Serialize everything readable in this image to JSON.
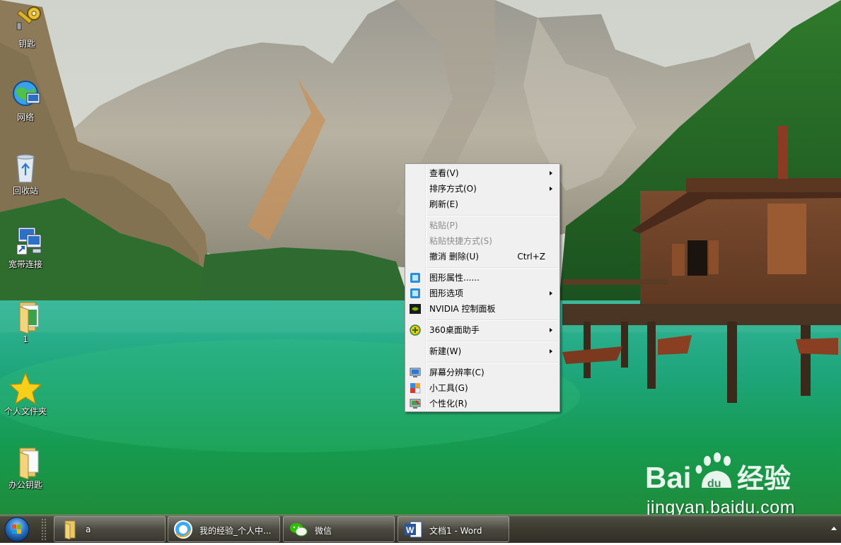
{
  "desktop_icons": [
    {
      "label": "钥匙",
      "icon": "key-icon"
    },
    {
      "label": "网络",
      "icon": "network-globe-icon"
    },
    {
      "label": "回收站",
      "icon": "recycle-bin-icon"
    },
    {
      "label": "宽带连接",
      "icon": "broadband-connection-icon"
    },
    {
      "label": "1",
      "icon": "folder-icon"
    },
    {
      "label": "个人文件夹",
      "icon": "star-folder-icon"
    },
    {
      "label": "办公钥匙",
      "icon": "folder-icon"
    }
  ],
  "context_menu": {
    "items": [
      {
        "label": "查看(V)",
        "submenu": true
      },
      {
        "label": "排序方式(O)",
        "submenu": true
      },
      {
        "label": "刷新(E)"
      },
      {
        "label": "粘贴(P)",
        "disabled": true
      },
      {
        "label": "粘贴快捷方式(S)",
        "disabled": true
      },
      {
        "label": "撤消 删除(U)",
        "shortcut": "Ctrl+Z"
      },
      {
        "label": "图形属性......",
        "icon": "intel-graphics-icon"
      },
      {
        "label": "图形选项",
        "icon": "intel-graphics-icon",
        "submenu": true
      },
      {
        "label": "NVIDIA 控制面板",
        "icon": "nvidia-icon"
      },
      {
        "label": "360桌面助手",
        "icon": "360-icon",
        "submenu": true
      },
      {
        "label": "新建(W)",
        "submenu": true
      },
      {
        "label": "屏幕分辨率(C)",
        "icon": "display-icon"
      },
      {
        "label": "小工具(G)",
        "icon": "gadgets-icon"
      },
      {
        "label": "个性化(R)",
        "icon": "personalize-icon"
      }
    ]
  },
  "taskbar": {
    "buttons": [
      {
        "label": "a",
        "icon": "folder-icon"
      },
      {
        "label": "我的经验_个人中...",
        "icon": "browser-icon"
      },
      {
        "label": "微信",
        "icon": "wechat-icon"
      },
      {
        "label": "文档1 - Word",
        "icon": "word-icon"
      }
    ]
  },
  "watermark": {
    "logo_text": "Bai du 经验",
    "url": "jingyan.baidu.com"
  },
  "colors": {
    "menu_bg": "#f0f0f0",
    "taskbar": "#3d3b31",
    "lake": "#1f9a6e"
  }
}
